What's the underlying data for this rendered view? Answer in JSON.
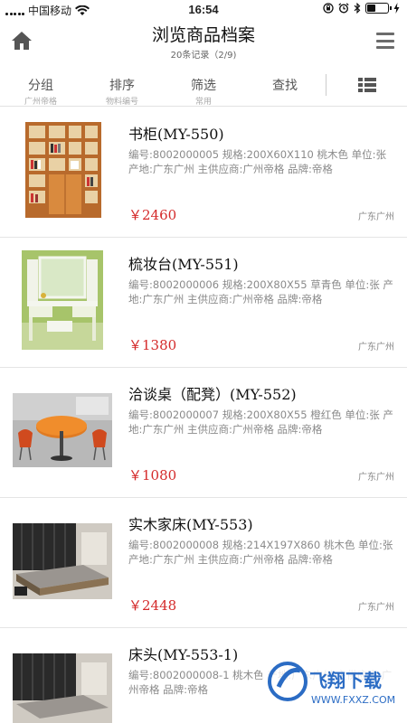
{
  "status_bar": {
    "carrier": "中国移动",
    "time": "16:54",
    "icons": [
      "signal-icon",
      "wifi-icon",
      "orientation-lock-icon",
      "alarm-icon",
      "bluetooth-icon",
      "battery-icon",
      "charging-icon"
    ]
  },
  "header": {
    "title": "浏览商品档案",
    "subtitle": "20条记录（2/9)"
  },
  "tabs": [
    {
      "label": "分组",
      "sub": "广州帝格"
    },
    {
      "label": "排序",
      "sub": "物料编号"
    },
    {
      "label": "筛选",
      "sub": "常用"
    },
    {
      "label": "查找",
      "sub": ""
    }
  ],
  "items": [
    {
      "name": "书柜(MY-550)",
      "desc": "编号:8002000005 规格:200X60X110 桃木色 单位:张 产地:广东广州 主供应商:广州帝格 品牌:帝格",
      "price": "￥2460",
      "region": "广东广州",
      "image": "bookcase"
    },
    {
      "name": "梳妆台(MY-551)",
      "desc": "编号:8002000006 规格:200X80X55 草青色 单位:张 产地:广东广州 主供应商:广州帝格 品牌:帝格",
      "price": "￥1380",
      "region": "广东广州",
      "image": "dresser"
    },
    {
      "name": "洽谈桌（配凳）(MY-552)",
      "desc": "编号:8002000007 规格:200X80X55 橙红色 单位:张 产地:广东广州 主供应商:广州帝格 品牌:帝格",
      "price": "￥1080",
      "region": "广东广州",
      "image": "table"
    },
    {
      "name": "实木家床(MY-553)",
      "desc": "编号:8002000008 规格:214X197X860 桃木色 单位:张 产地:广东广州 主供应商:广州帝格 品牌:帝格",
      "price": "￥2448",
      "region": "广东广州",
      "image": "bed"
    },
    {
      "name": "床头(MY-553-1)",
      "desc": "编号:8002000008-1 桃木色 产地:广东广州 主供应商:广州帝格 品牌:帝格",
      "price": "",
      "region": "",
      "image": "headboard"
    }
  ],
  "watermark": {
    "line1": "飞翔下载",
    "line2": "WWW.FXXZ.COM"
  },
  "colors": {
    "price": "#d42a2a",
    "text": "#222222",
    "muted": "#8a8a8a"
  }
}
